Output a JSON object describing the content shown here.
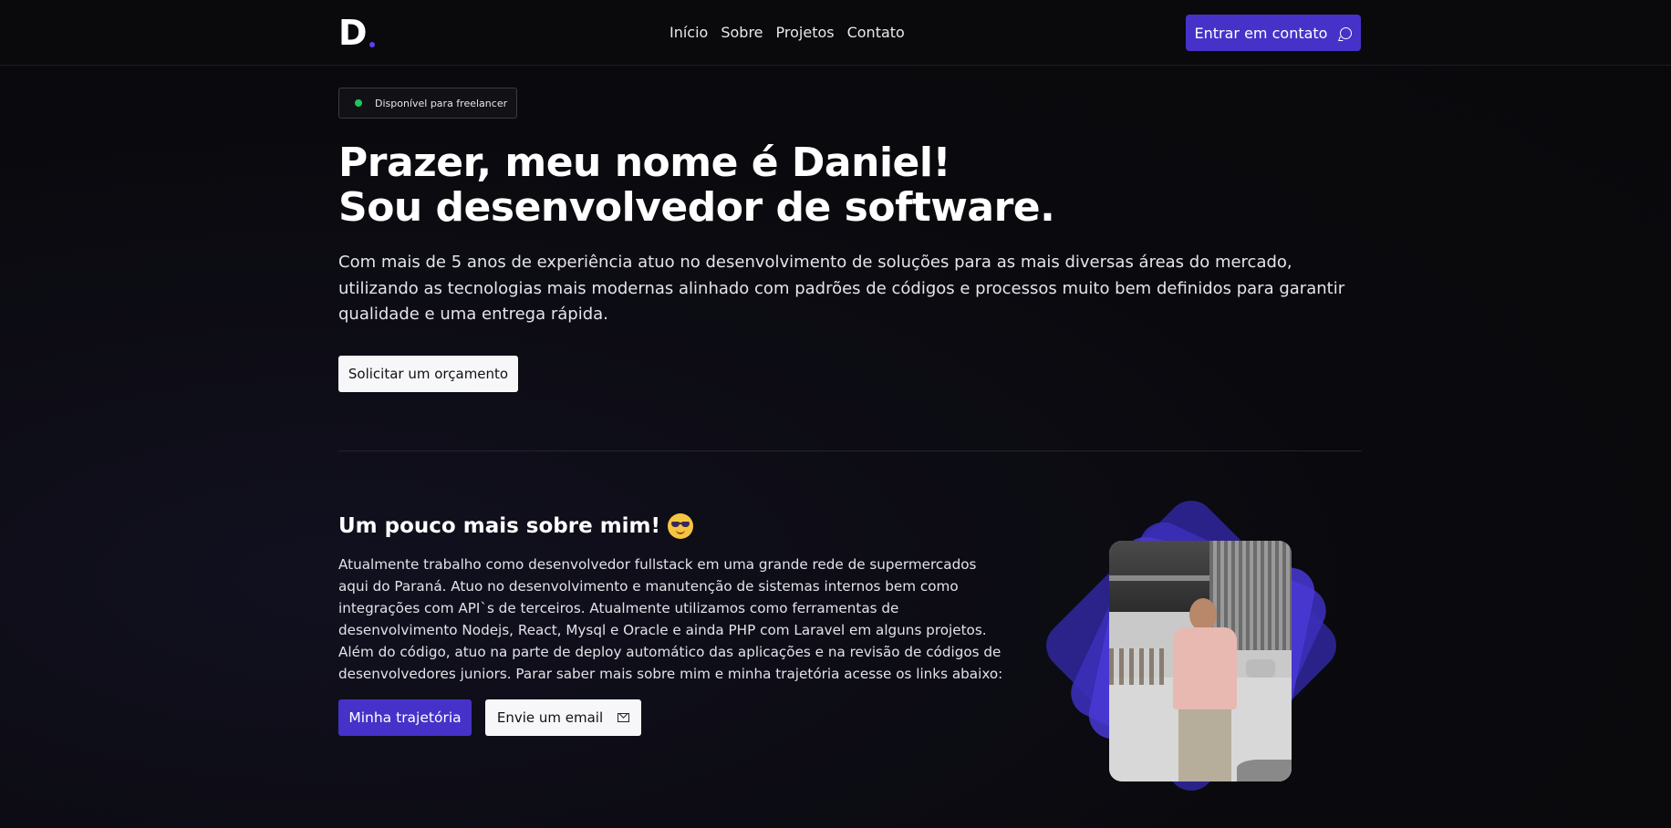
{
  "header": {
    "logo": "D",
    "nav": [
      "Início",
      "Sobre",
      "Projetos",
      "Contato"
    ],
    "contact_button": "Entrar em contato",
    "contact_icon": "chat-bubble-icon"
  },
  "hero": {
    "badge": "Disponível para freelancer",
    "title_line1": "Prazer, meu nome é Daniel!",
    "title_line2": "Sou desenvolvedor de software.",
    "description": "Com mais de 5 anos de experiência atuo no desenvolvimento de soluções para as mais diversas áreas do mercado, utilizando as tecnologias mais modernas alinhado com padrões de códigos e processos muito bem definidos para garantir qualidade e uma entrega rápida.",
    "quote_button": "Solicitar um orçamento"
  },
  "about": {
    "title": "Um pouco mais sobre mim!",
    "emoji": "smiling-face-with-sunglasses",
    "text": "Atualmente trabalho como desenvolvedor fullstack em uma grande rede de supermercados aqui do Paraná. Atuo no desenvolvimento e manutenção de sistemas internos bem como integrações com API`s de terceiros. Atualmente utilizamos como ferramentas de desenvolvimento Nodejs, React, Mysql e Oracle e ainda PHP com Laravel em alguns projetos. Além do código, atuo na parte de deploy automático das aplicações e na revisão de códigos de desenvolvedores juniors. Parar saber mais sobre mim e minha trajetória acesse os links abaixo:",
    "journey_button": "Minha trajetória",
    "email_button": "Envie um email",
    "email_icon": "envelope-icon"
  },
  "colors": {
    "accent": "#4632c9",
    "available_dot": "#22c55e",
    "background": "#0a0a0e"
  }
}
